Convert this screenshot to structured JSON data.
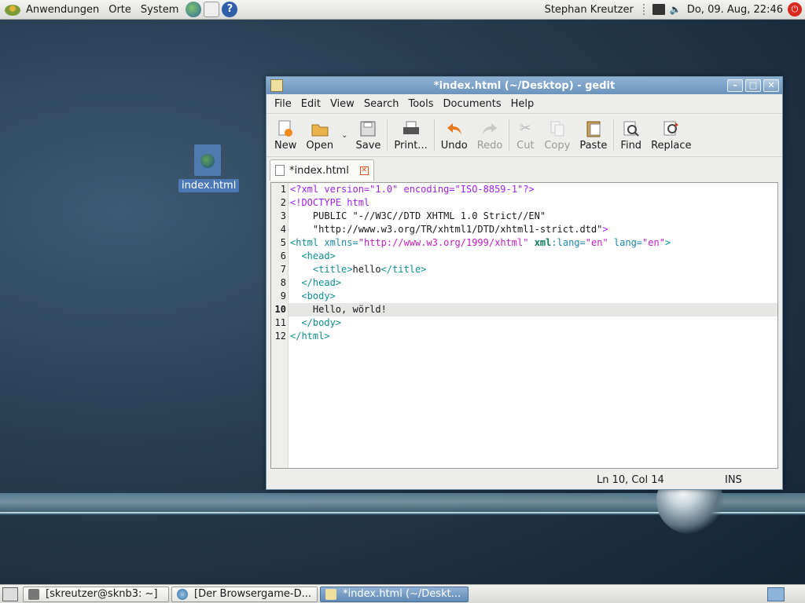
{
  "top_panel": {
    "menus": [
      "Anwendungen",
      "Orte",
      "System"
    ],
    "user": "Stephan Kreutzer",
    "clock": "Do, 09. Aug, 22:46"
  },
  "desktop": {
    "icon_label": "index.html"
  },
  "window": {
    "title": "*index.html (~/Desktop) - gedit",
    "menu": [
      "File",
      "Edit",
      "View",
      "Search",
      "Tools",
      "Documents",
      "Help"
    ],
    "toolbar": {
      "new": "New",
      "open": "Open",
      "save": "Save",
      "print": "Print...",
      "undo": "Undo",
      "redo": "Redo",
      "cut": "Cut",
      "copy": "Copy",
      "paste": "Paste",
      "find": "Find",
      "replace": "Replace"
    },
    "tab_label": "*index.html",
    "line_numbers": [
      "1",
      "2",
      "3",
      "4",
      "5",
      "6",
      "7",
      "8",
      "9",
      "10",
      "11",
      "12"
    ],
    "status": {
      "position": "Ln 10, Col 14",
      "mode": "INS"
    }
  },
  "taskbar": {
    "tasks": [
      "[skreutzer@sknb3: ~]",
      "[Der Browsergame-D...",
      "*index.html (~/Deskt..."
    ]
  },
  "colors": {
    "desktop_bg": "#233a4e",
    "titlebar": "#7aa0c8",
    "tag": "#0d8f8f",
    "string": "#c21dc2"
  }
}
